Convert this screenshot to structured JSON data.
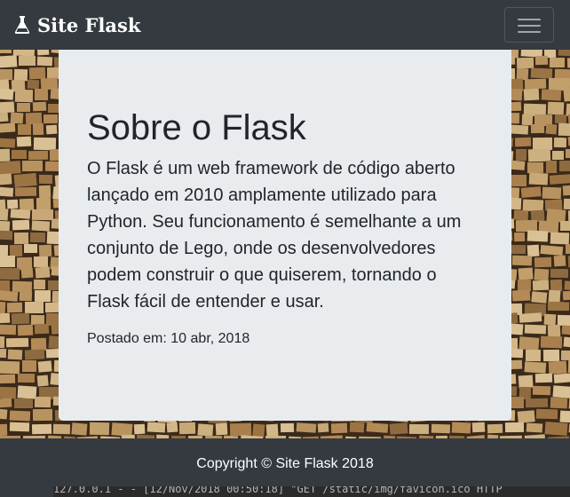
{
  "navbar": {
    "brand": "Site Flask",
    "brand_icon": "flask-icon",
    "toggler_icon": "hamburger-menu-icon"
  },
  "hero": {
    "background": "wood-blocks-image",
    "title": "Sobre o Flask",
    "text": "O Flask é um web framework de código aberto lançado em 2010 amplamente utilizado para Python. Seu funcionamento é semelhante a um conjunto de Lego, onde os desenvolvedores podem construir o que quiserem, tornando o Flask fácil de entender e usar.",
    "posted": "Postado em: 10 abr, 2018"
  },
  "footer": {
    "copyright": "Copyright © Site Flask 2018"
  },
  "terminal": {
    "line": "127.0.0.1 - - [12/Nov/2018 00:50:18] \"GET /static/img/favicon.ico HTTP"
  },
  "colors": {
    "navbar": "#343a40",
    "card": "#e9ecef",
    "text": "#212529"
  }
}
